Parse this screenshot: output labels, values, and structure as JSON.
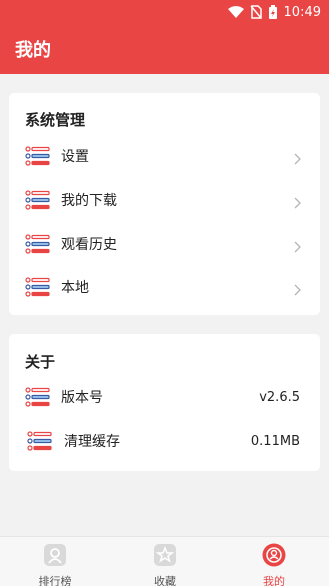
{
  "status_bar": {
    "time": "10:49"
  },
  "app_bar": {
    "title": "我的"
  },
  "system_section": {
    "title": "系统管理",
    "items": [
      {
        "label": "设置"
      },
      {
        "label": "我的下载"
      },
      {
        "label": "观看历史"
      },
      {
        "label": "本地"
      }
    ]
  },
  "about_section": {
    "title": "关于",
    "items": [
      {
        "label": "版本号",
        "value": "v2.6.5"
      },
      {
        "label": "清理缓存",
        "value": "0.11MB"
      }
    ]
  },
  "bottom_nav": {
    "items": [
      {
        "label": "排行榜",
        "icon": "ranking-icon"
      },
      {
        "label": "收藏",
        "icon": "favorites-icon"
      },
      {
        "label": "我的",
        "icon": "profile-icon"
      }
    ],
    "active_index": 2
  },
  "colors": {
    "accent": "#e94545",
    "background": "#f2f2f2"
  }
}
